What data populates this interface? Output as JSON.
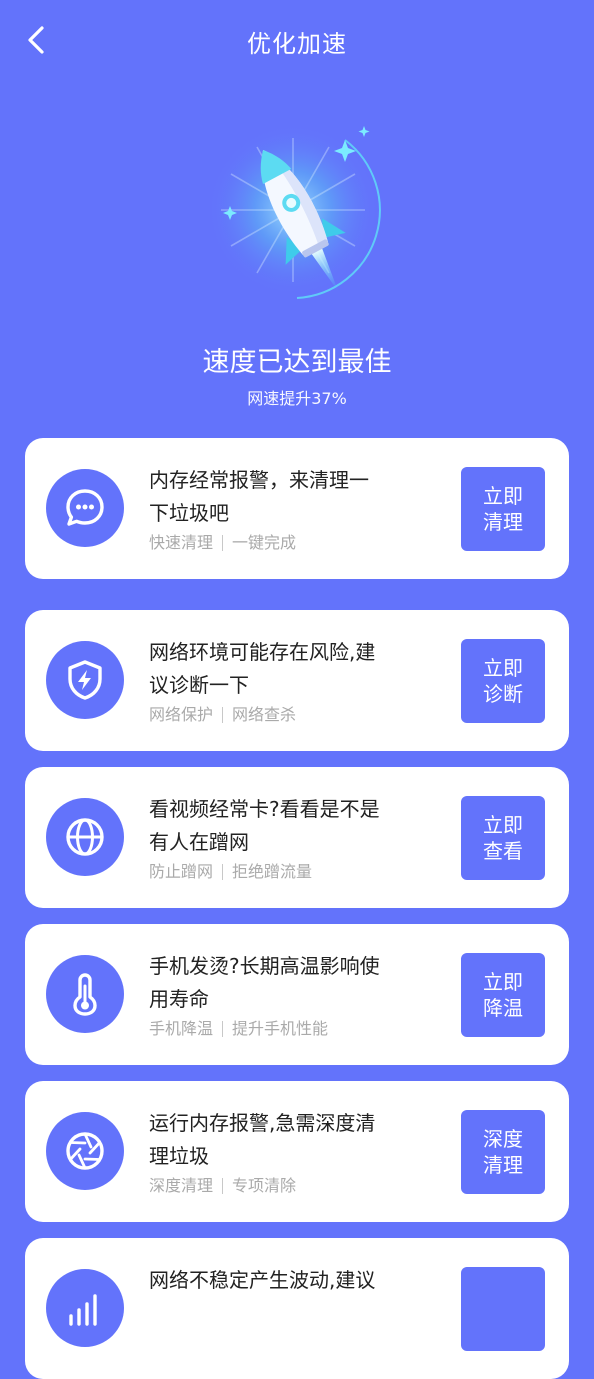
{
  "header": {
    "title": "优化加速"
  },
  "status": {
    "title": "速度已达到最佳",
    "subtitle": "网速提升37%"
  },
  "colors": {
    "background": "#6373FB",
    "card": "#FFFFFF",
    "accent": "#6373FB",
    "tag_text": "#AAAAAA",
    "title_text": "#222222",
    "rocket_glow": "#4DD9F5"
  },
  "cards": [
    {
      "icon": "chat-bubble-icon",
      "title_line1": "内存经常报警，来清理一",
      "title_line2": "下垃圾吧",
      "tag1": "快速清理",
      "tag2": "一键完成",
      "button_line1": "立即",
      "button_line2": "清理"
    },
    {
      "icon": "shield-bolt-icon",
      "title_line1": "网络环境可能存在风险,建",
      "title_line2": "议诊断一下",
      "tag1": "网络保护",
      "tag2": "网络查杀",
      "button_line1": "立即",
      "button_line2": "诊断"
    },
    {
      "icon": "globe-icon",
      "title_line1": "看视频经常卡?看看是不是",
      "title_line2": "有人在蹭网",
      "tag1": "防止蹭网",
      "tag2": "拒绝蹭流量",
      "button_line1": "立即",
      "button_line2": "查看"
    },
    {
      "icon": "thermometer-icon",
      "title_line1": "手机发烫?长期高温影响使",
      "title_line2": "用寿命",
      "tag1": "手机降温",
      "tag2": "提升手机性能",
      "button_line1": "立即",
      "button_line2": "降温"
    },
    {
      "icon": "aperture-icon",
      "title_line1": "运行内存报警,急需深度清",
      "title_line2": "理垃圾",
      "tag1": "深度清理",
      "tag2": "专项清除",
      "button_line1": "深度",
      "button_line2": "清理"
    },
    {
      "icon": "signal-icon",
      "title_line1": "网络不稳定产生波动,建议",
      "title_line2": "",
      "tag1": "",
      "tag2": "",
      "button_line1": "",
      "button_line2": ""
    }
  ]
}
